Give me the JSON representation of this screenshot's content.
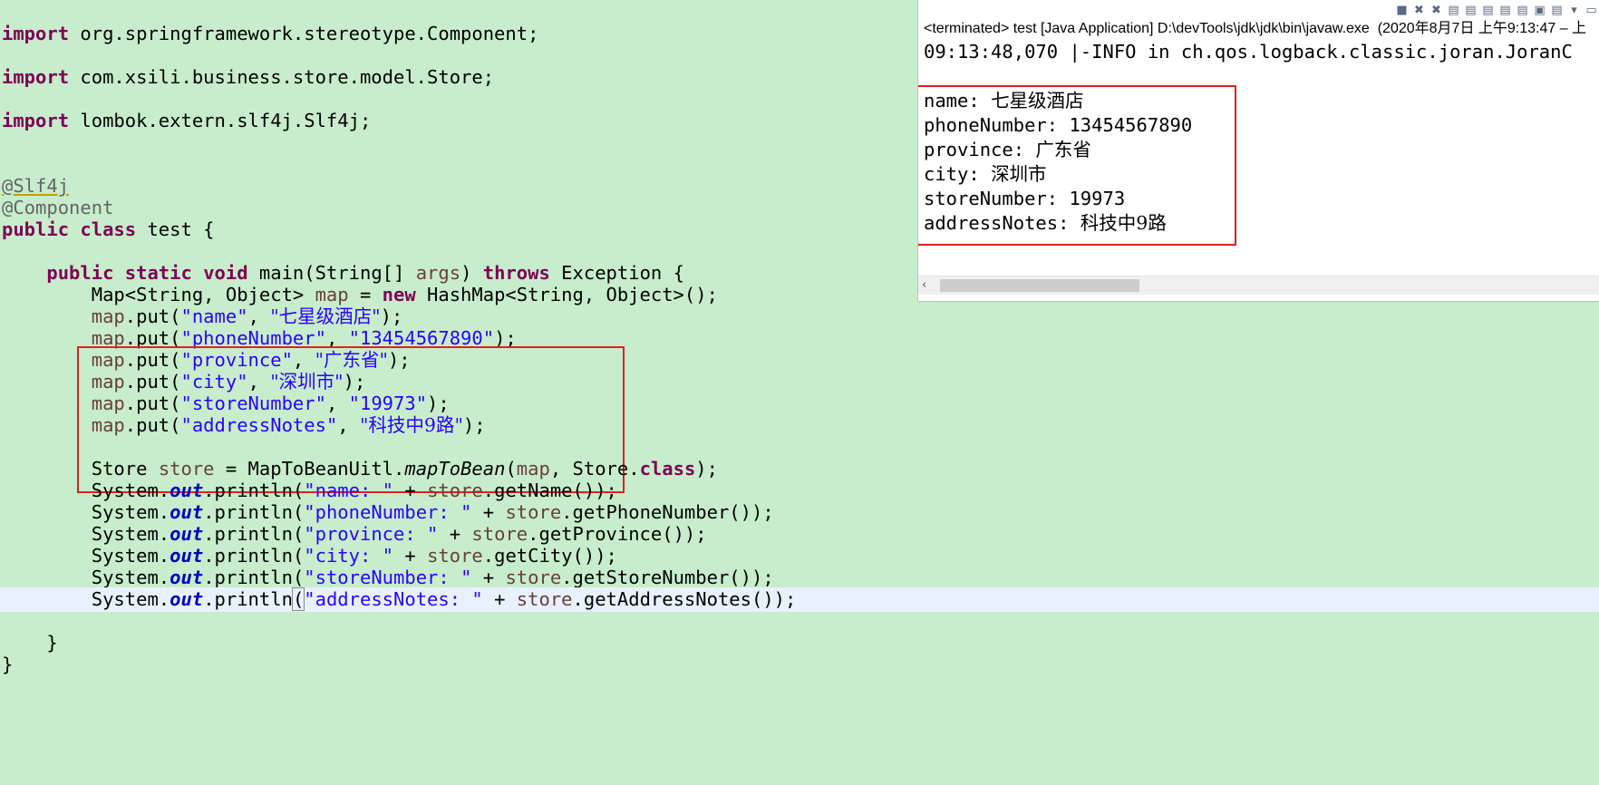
{
  "editor": {
    "imports": {
      "kw": "import",
      "component": " org.springframework.stereotype.Component;",
      "store": " com.xsili.business.store.model.Store;",
      "slf4j": " lombok.extern.slf4j.Slf4j;"
    },
    "annotations": {
      "slf4j": "@Slf4j",
      "component": "@Component"
    },
    "class_decl": {
      "kw_public": "public",
      "kw_class": "class",
      "name": " test {"
    },
    "main_decl": {
      "kw_public": "public",
      "kw_static": "static",
      "kw_void": "void",
      "sig": " main(String[] ",
      "args": "args",
      "close_paren": ") ",
      "kw_throws": "throws",
      "exception": " Exception {"
    },
    "map_decl": {
      "type": "Map<String, Object> ",
      "var": "map",
      "assign": " = ",
      "kw_new": "new",
      "ctor": " HashMap<String, Object>();"
    },
    "map_puts": [
      {
        "key": "\"name\"",
        "value": "\"七星级酒店\""
      },
      {
        "key": "\"phoneNumber\"",
        "value": "\"13454567890\""
      },
      {
        "key": "\"province\"",
        "value": "\"广东省\""
      },
      {
        "key": "\"city\"",
        "value": "\"深圳市\""
      },
      {
        "key": "\"storeNumber\"",
        "value": "\"19973\""
      },
      {
        "key": "\"addressNotes\"",
        "value": "\"科技中9路\""
      }
    ],
    "store_decl": {
      "type": "Store ",
      "var": "store",
      "assign": " = MapToBeanUitl.",
      "method": "mapToBean",
      "open": "(",
      "arg": "map",
      "rest": ", Store.",
      "kw_class": "class",
      "end": ");"
    },
    "printlns": [
      {
        "label": "\"name: \"",
        "getter": ".getName());"
      },
      {
        "label": "\"phoneNumber: \"",
        "getter": ".getPhoneNumber());"
      },
      {
        "label": "\"province: \"",
        "getter": ".getProvince());"
      },
      {
        "label": "\"city: \"",
        "getter": ".getCity());"
      },
      {
        "label": "\"storeNumber: \"",
        "getter": ".getStoreNumber());"
      },
      {
        "label": "\"addressNotes: \"",
        "getter": ".getAddressNotes());"
      }
    ],
    "tokens": {
      "map": "map",
      "put_open": ".put(",
      "comma": ", ",
      "close": ");",
      "system": "System.",
      "out": "out",
      "println": ".println",
      "paren": "(",
      "plus": " + ",
      "store": "store",
      "brace_close": "}"
    }
  },
  "console": {
    "title": "<terminated> test [Java Application] D:\\devTools\\jdk\\jdk\\bin\\javaw.exe  (2020年8月7日 上午9:13:47 – 上",
    "log_line": "09:13:48,070 |-INFO in ch.qos.logback.classic.joran.JoranC",
    "output": [
      {
        "label": "name: ",
        "value": "七星级酒店"
      },
      {
        "label": "phoneNumber: ",
        "value": "13454567890"
      },
      {
        "label": "province: ",
        "value": "广东省"
      },
      {
        "label": "city: ",
        "value": "深圳市"
      },
      {
        "label": "storeNumber: ",
        "value": "19973"
      },
      {
        "label": "addressNotes: ",
        "value": "科技中9路"
      }
    ],
    "toolbar_icons": [
      "■",
      "✖",
      "✖",
      "▤",
      "▤",
      "▤",
      "▤",
      "▤",
      "▣",
      "▤",
      "▾",
      "▭"
    ]
  },
  "colors": {
    "editor_bg": "#c7edcc",
    "keyword": "#7f0055",
    "string": "#2a00ff",
    "field": "#6a3e3e",
    "highlight_border": "#e0201f",
    "current_line": "#e8f2fe"
  }
}
